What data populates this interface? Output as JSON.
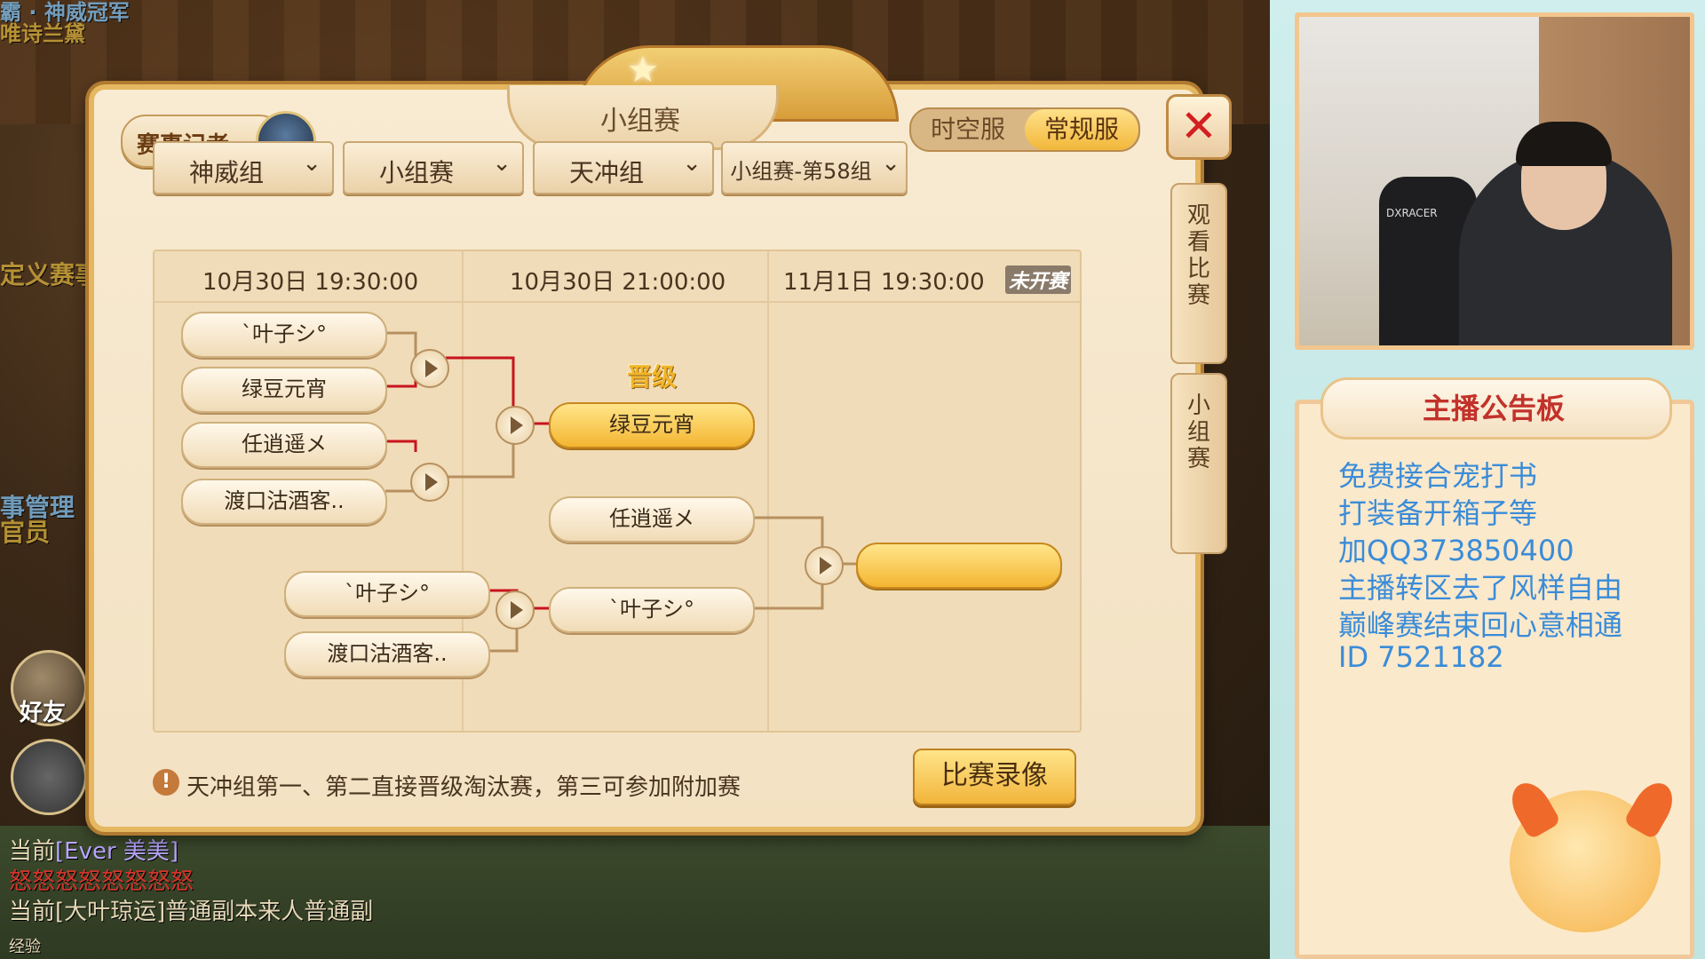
{
  "background": {
    "top_banner": "霸 · 神威冠军",
    "top_banner_sub": "唯诗兰黛",
    "left_label_1": "定义赛事",
    "left_label_2": "事管理",
    "left_label_3": "官员",
    "friends_label": "好友",
    "chat": [
      {
        "prefix": "当前",
        "text": "[Ever    美美]"
      },
      {
        "prefix": "",
        "text": "怒怒怒怒怒怒怒怒"
      },
      {
        "prefix": "当前",
        "text": "[大叶琼运]普通副本来人普通副"
      }
    ],
    "exp_label": "经验"
  },
  "panel": {
    "title": "小组赛",
    "reporter_label": "赛事记者",
    "server_options": [
      "时空服",
      "常规服"
    ],
    "active_server": "常规服",
    "close_icon": "close-icon",
    "dropdowns": [
      "神威组",
      "小组赛",
      "天冲组",
      "小组赛-第58组"
    ],
    "dates": [
      "10月30日  19:30:00",
      "10月30日  21:00:00",
      "11月1日  19:30:00"
    ],
    "not_started": "未开赛",
    "promote_label": "晋级",
    "round1": [
      "`叶子シ°",
      "绿豆元宵",
      "任逍遥メ",
      "渡口沽酒客.."
    ],
    "round1b": [
      "`叶子シ°",
      "渡口沽酒客.."
    ],
    "round2": [
      "绿豆元宵",
      "任逍遥メ",
      "`叶子シ°"
    ],
    "final": "",
    "info_text": "天冲组第一、第二直接晋级淘汰赛，第三可参加附加赛",
    "replay_button": "比赛录像",
    "side_tabs": [
      "观看比赛",
      "小组赛"
    ]
  },
  "streamer": {
    "board_title": "主播公告板",
    "board_lines": [
      "免费接合宠打书",
      "打装备开箱子等",
      "加QQ373850400",
      "主播转区去了风样自由",
      "巅峰赛结束回心意相通",
      "ID 7521182"
    ],
    "chair_brand": "DXRACER"
  },
  "colors": {
    "accent_gold": "#f4b632",
    "bracket_line_red": "#c8141e",
    "board_text": "#3a8cd8",
    "board_title": "#c2322a"
  }
}
